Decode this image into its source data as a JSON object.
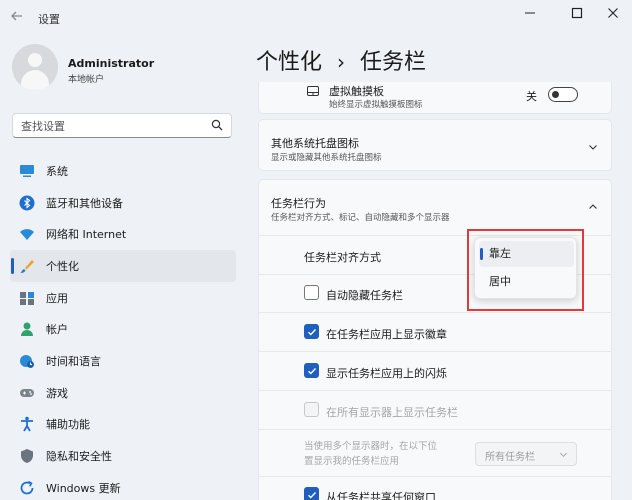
{
  "window": {
    "title": "设置"
  },
  "user": {
    "name": "Administrator",
    "account_type": "本地帐户"
  },
  "search": {
    "placeholder": "查找设置"
  },
  "sidebar": {
    "items": [
      {
        "label": "系统",
        "icon": "monitor-icon"
      },
      {
        "label": "蓝牙和其他设备",
        "icon": "bluetooth-icon"
      },
      {
        "label": "网络和 Internet",
        "icon": "wifi-icon"
      },
      {
        "label": "个性化",
        "icon": "brush-icon",
        "active": true
      },
      {
        "label": "应用",
        "icon": "apps-icon"
      },
      {
        "label": "帐户",
        "icon": "person-icon"
      },
      {
        "label": "时间和语言",
        "icon": "globe-clock-icon"
      },
      {
        "label": "游戏",
        "icon": "gamepad-icon"
      },
      {
        "label": "辅助功能",
        "icon": "accessibility-icon"
      },
      {
        "label": "隐私和安全性",
        "icon": "shield-icon"
      },
      {
        "label": "Windows 更新",
        "icon": "update-icon"
      }
    ]
  },
  "breadcrumb": {
    "parent": "个性化",
    "separator": "›",
    "current": "任务栏"
  },
  "touchpad": {
    "title": "虚拟触摸板",
    "subtitle": "始终显示虚拟触摸板图标",
    "toggle_label": "关",
    "toggle_on": false
  },
  "tray_icons": {
    "title": "其他系统托盘图标",
    "subtitle": "显示或隐藏其他系统托盘图标"
  },
  "behaviors": {
    "title": "任务栏行为",
    "subtitle": "任务栏对齐方式、标记、自动隐藏和多个显示器",
    "alignment_label": "任务栏对齐方式",
    "alignment_options": [
      "靠左",
      "居中"
    ],
    "alignment_selected": "靠左",
    "auto_hide": {
      "label": "自动隐藏任务栏",
      "checked": false
    },
    "show_badges": {
      "label": "在任务栏应用上显示徽章",
      "checked": true
    },
    "show_flashing": {
      "label": "显示任务栏应用上的闪烁",
      "checked": true
    },
    "all_displays": {
      "label": "在所有显示器上显示任务栏",
      "checked": false,
      "disabled": true
    },
    "multi_display_text_1": "当使用多个显示器时，在以下位",
    "multi_display_text_2": "置显示我的任务栏应用",
    "multi_display_value": "所有任务栏",
    "share_window": {
      "label": "从任务栏共享任何窗口",
      "checked": true
    }
  },
  "colors": {
    "accent": "#1f5fbd",
    "highlight": "#e03a3a"
  }
}
